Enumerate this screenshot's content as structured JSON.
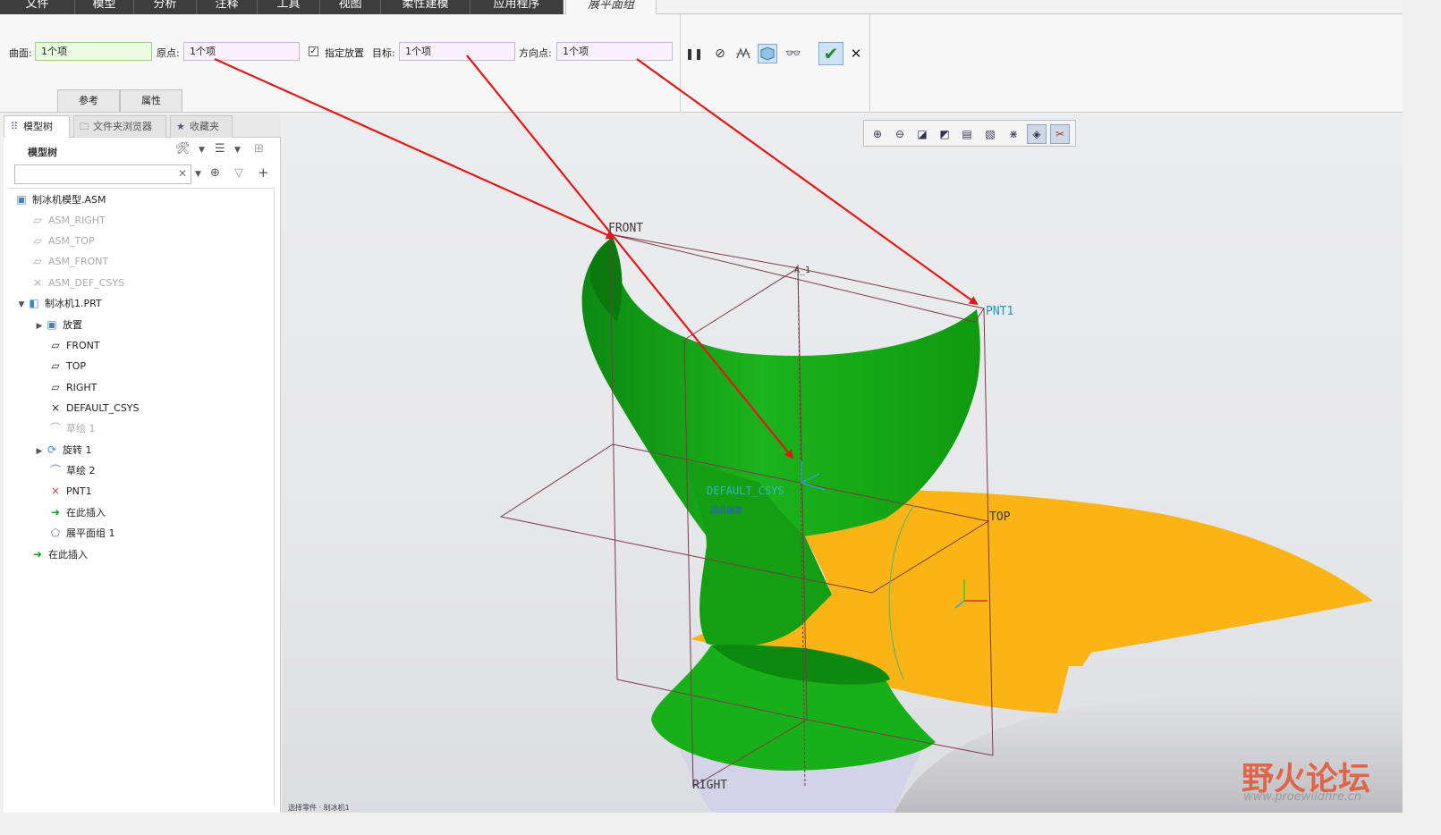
{
  "menu": {
    "tabs": [
      "文件",
      "模型",
      "分析",
      "注释",
      "工具",
      "视图",
      "柔性建模",
      "应用程序",
      "展平面组"
    ],
    "active_tab": "展平面组"
  },
  "dashboard": {
    "surface_label": "曲面:",
    "surface_value": "1个项",
    "origin_label": "原点:",
    "origin_value": "1个项",
    "specify_placement_label": "指定放置",
    "specify_placement_checked": true,
    "target_label": "目标:",
    "target_value": "1个项",
    "direction_label": "方向点:",
    "direction_value": "1个项",
    "subtabs": [
      "参考",
      "属性"
    ]
  },
  "left_panel": {
    "tabs": [
      "模型树",
      "文件夹浏览器",
      "收藏夹"
    ],
    "title": "模型树",
    "search_placeholder": "",
    "tree": [
      {
        "label": "制冰机模型.ASM",
        "icon": "assembly-icon",
        "dim": false
      },
      {
        "label": "ASM_RIGHT",
        "icon": "datum-plane-icon",
        "dim": true
      },
      {
        "label": "ASM_TOP",
        "icon": "datum-plane-icon",
        "dim": true
      },
      {
        "label": "ASM_FRONT",
        "icon": "datum-plane-icon",
        "dim": true
      },
      {
        "label": "ASM_DEF_CSYS",
        "icon": "csys-icon",
        "dim": true
      },
      {
        "label": "制冰机1.PRT",
        "icon": "part-icon",
        "dim": false
      },
      {
        "label": "放置",
        "icon": "placement-icon",
        "dim": false
      },
      {
        "label": "FRONT",
        "icon": "datum-plane-icon",
        "dim": false
      },
      {
        "label": "TOP",
        "icon": "datum-plane-icon",
        "dim": false
      },
      {
        "label": "RIGHT",
        "icon": "datum-plane-icon",
        "dim": false
      },
      {
        "label": "DEFAULT_CSYS",
        "icon": "csys-icon",
        "dim": false
      },
      {
        "label": "草绘 1",
        "icon": "sketch-icon",
        "dim": true
      },
      {
        "label": "旋转 1",
        "icon": "revolve-icon",
        "dim": false
      },
      {
        "label": "草绘 2",
        "icon": "sketch-icon",
        "dim": false
      },
      {
        "label": "PNT1",
        "icon": "datum-point-icon",
        "dim": false
      },
      {
        "label": "在此插入",
        "icon": "insert-here-icon",
        "dim": false
      },
      {
        "label": "展平面组 1",
        "icon": "flatten-quilt-icon",
        "dim": false
      },
      {
        "label": "在此插入",
        "icon": "insert-here-icon",
        "dim": false
      }
    ]
  },
  "viewport": {
    "labels": {
      "front": "FRONT",
      "pnt": "PNT1",
      "top": "TOP",
      "right": "RIGHT",
      "csys": "DEFAULT_CSYS",
      "axis": "A_1",
      "csys_tag": "源组曲面"
    },
    "colors": {
      "quilt_green": "#14a514",
      "flattened_orange": "#fbb416",
      "annotation_arrow": "#e11818",
      "datum_lines": "#7a3a46"
    },
    "status": "选择零件 · 制冰机1"
  },
  "watermark": {
    "main": "野火论坛",
    "url": "www.proewildfire.cn"
  }
}
